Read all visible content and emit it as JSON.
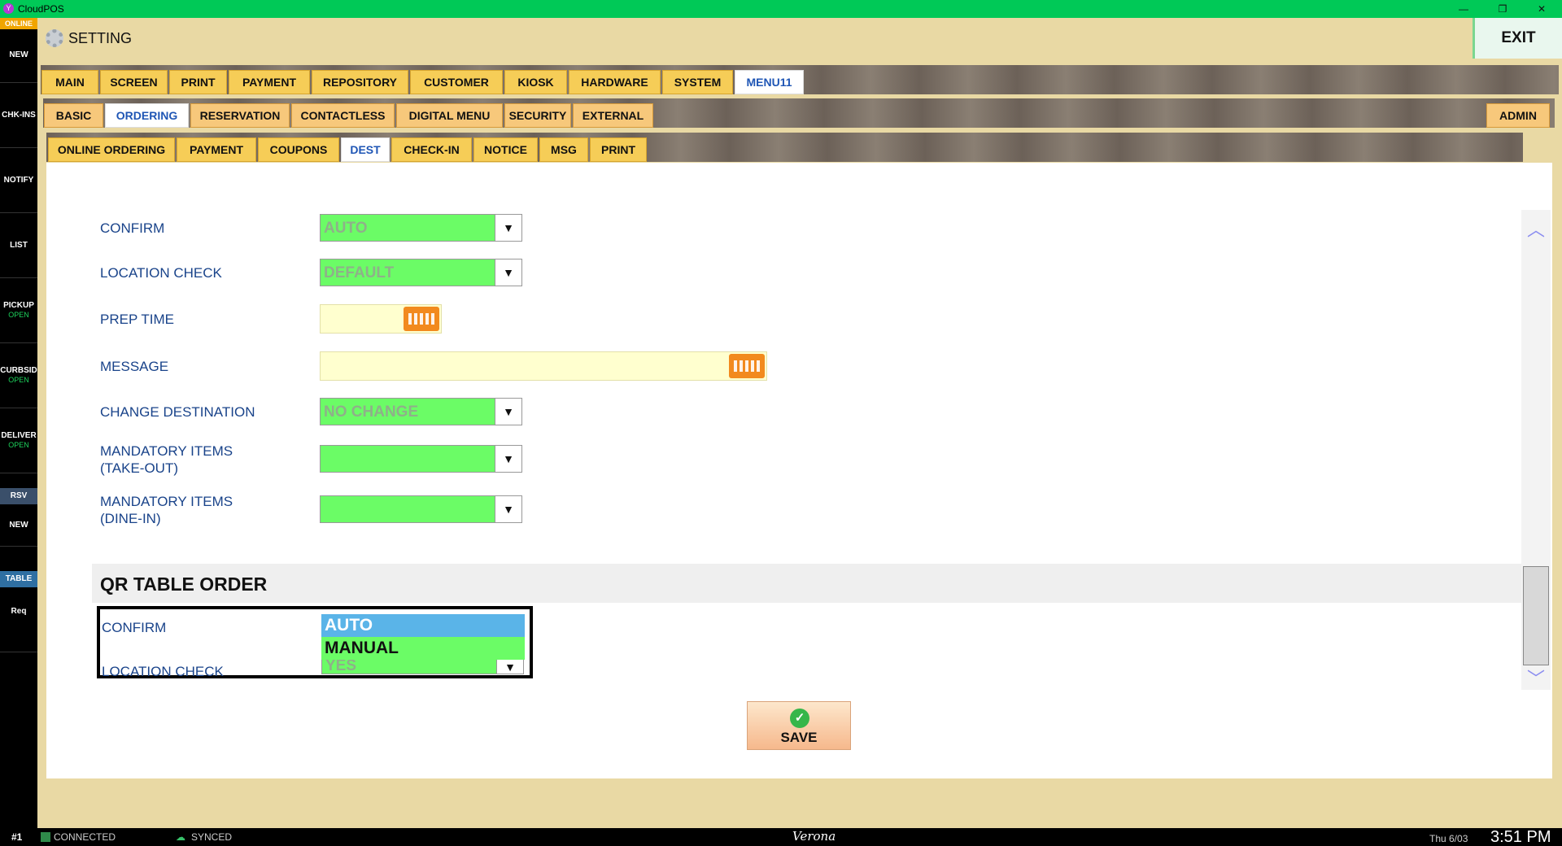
{
  "titlebar": {
    "app": "CloudPOS",
    "minimize": "—",
    "restore": "❐",
    "close": "✕"
  },
  "sidebar": {
    "online": "ONLINE",
    "items": [
      {
        "label": "NEW",
        "sub": ""
      },
      {
        "label": "CHK-INS",
        "sub": ""
      },
      {
        "label": "NOTIFY",
        "sub": ""
      },
      {
        "label": "LIST",
        "sub": ""
      },
      {
        "label": "PICKUP",
        "sub": "OPEN"
      },
      {
        "label": "CURBSID",
        "sub": "OPEN"
      },
      {
        "label": "DELIVER",
        "sub": "OPEN"
      }
    ],
    "rsv": "RSV",
    "rsv_new": "NEW",
    "table": "TABLE",
    "req": "Req"
  },
  "header": {
    "title": "SETTING",
    "exit": "EXIT"
  },
  "tabs1": [
    "MAIN",
    "SCREEN",
    "PRINT",
    "PAYMENT",
    "REPOSITORY",
    "CUSTOMER",
    "KIOSK",
    "HARDWARE",
    "SYSTEM",
    "MENU11"
  ],
  "tabs2": [
    "BASIC",
    "ORDERING",
    "RESERVATION",
    "CONTACTLESS",
    "DIGITAL MENU",
    "SECURITY",
    "EXTERNAL"
  ],
  "tabs2_admin": "ADMIN",
  "tabs3": [
    "ONLINE ORDERING",
    "PAYMENT",
    "COUPONS",
    "DEST",
    "CHECK-IN",
    "NOTICE",
    "MSG",
    "PRINT"
  ],
  "form": {
    "confirm_label": "CONFIRM",
    "confirm_value": "AUTO",
    "location_label": "LOCATION CHECK",
    "location_value": "DEFAULT",
    "prep_label": "PREP TIME",
    "message_label": "MESSAGE",
    "change_dest_label": "CHANGE DESTINATION",
    "change_dest_value": "NO CHANGE",
    "mand_takeout_label1": "MANDATORY ITEMS",
    "mand_takeout_label2": "(TAKE-OUT)",
    "mand_dinein_label1": "MANDATORY ITEMS",
    "mand_dinein_label2": "(DINE-IN)"
  },
  "qr": {
    "title": "QR TABLE ORDER",
    "confirm_label": "CONFIRM",
    "location_label": "LOCATION CHECK",
    "location_value": "YES",
    "options": [
      "AUTO",
      "MANUAL"
    ]
  },
  "save_label": "SAVE",
  "status": {
    "station": "#1",
    "connected": "CONNECTED",
    "synced": "SYNCED",
    "store": "Verona",
    "date": "Thu 6/03",
    "time": "3:51 PM"
  },
  "colors": {
    "accent_green": "#00c957",
    "tab_yellow": "#f6cd57",
    "select_green": "#6bfc66",
    "selected_option": "#5ab4e8"
  }
}
